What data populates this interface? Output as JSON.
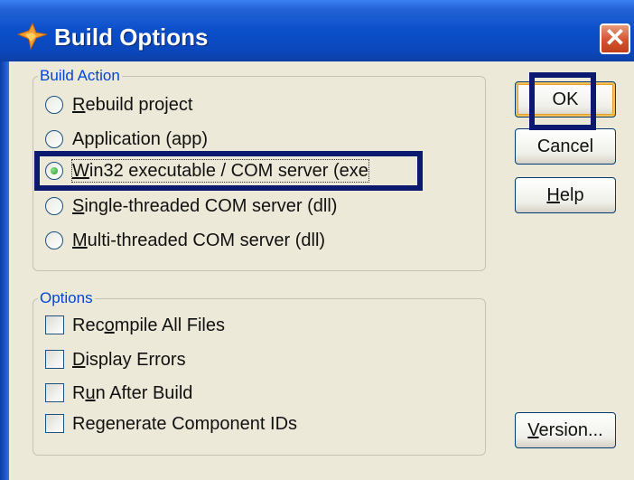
{
  "window": {
    "title": "Build Options",
    "close_glyph": "✕"
  },
  "build_action": {
    "label": "Build Action",
    "options": [
      {
        "pre": "",
        "ul": "R",
        "post": "ebuild project",
        "selected": false
      },
      {
        "pre": "",
        "ul": "",
        "post": "Application (app)",
        "selected": false
      },
      {
        "pre": "",
        "ul": "W",
        "post": "in32 executable / COM server (exe",
        "selected": true
      },
      {
        "pre": "",
        "ul": "S",
        "post": "ingle-threaded COM server (dll)",
        "selected": false
      },
      {
        "pre": "",
        "ul": "M",
        "post": "ulti-threaded COM server (dll)",
        "selected": false
      }
    ]
  },
  "options": {
    "label": "Options",
    "items": [
      {
        "pre": "Rec",
        "ul": "o",
        "post": "mpile All Files",
        "checked": false
      },
      {
        "pre": "",
        "ul": "D",
        "post": "isplay Errors",
        "checked": false
      },
      {
        "pre": "R",
        "ul": "u",
        "post": "n After Build",
        "checked": false
      },
      {
        "pre": "",
        "ul": "",
        "post": "Regenerate Component IDs",
        "checked": false
      }
    ]
  },
  "buttons": {
    "ok": {
      "pre": "OK",
      "ul": "",
      "post": ""
    },
    "cancel": {
      "pre": "Cancel",
      "ul": "",
      "post": ""
    },
    "help": {
      "pre": "",
      "ul": "H",
      "post": "elp"
    },
    "version": {
      "pre": "",
      "ul": "V",
      "post": "ersion..."
    }
  },
  "colors": {
    "title_bar": "#0a4fc9",
    "group_label": "#0046d5",
    "highlight_box": "#0b1a6e",
    "radio_selected": "#21a121"
  }
}
